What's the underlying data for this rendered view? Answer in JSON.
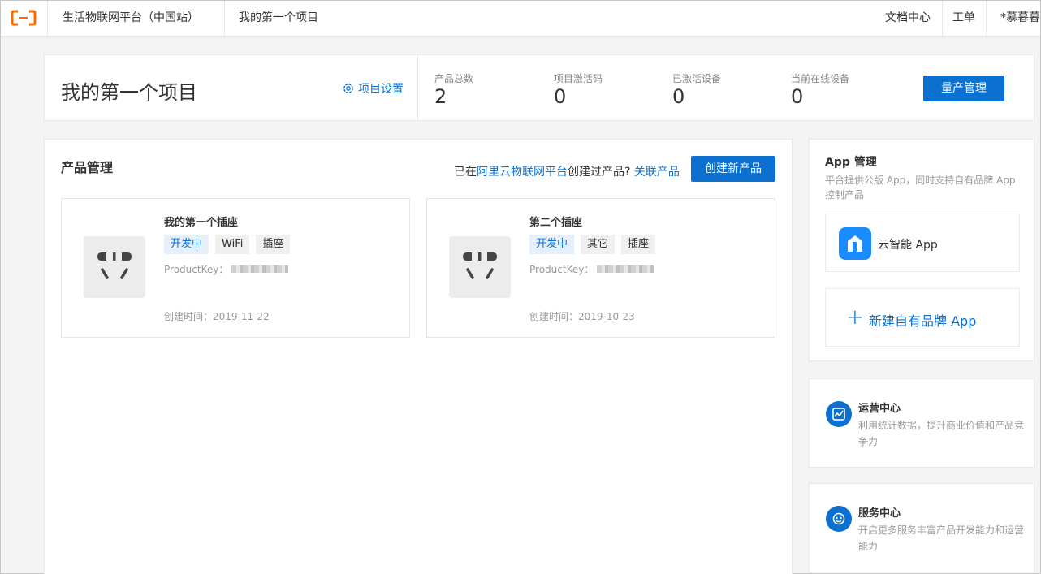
{
  "topbar": {
    "platform": "生活物联网平台（中国站）",
    "project": "我的第一个项目",
    "docs": "文档中心",
    "ticket": "工单",
    "user": "*慕暮暮"
  },
  "project": {
    "title": "我的第一个项目",
    "settings": "项目设置",
    "stats": [
      {
        "label": "产品总数",
        "value": "2"
      },
      {
        "label": "项目激活码",
        "value": "0"
      },
      {
        "label": "已激活设备",
        "value": "0"
      },
      {
        "label": "当前在线设备",
        "value": "0"
      }
    ],
    "mass_button": "量产管理"
  },
  "products": {
    "title": "产品管理",
    "link_prefix": "已在",
    "link_platform": "阿里云物联网平台",
    "link_middle": "创建过产品?",
    "link_associate": "关联产品",
    "create_button": "创建新产品",
    "items": [
      {
        "name": "我的第一个插座",
        "tags": [
          "开发中",
          "WiFi",
          "插座"
        ],
        "pk_label": "ProductKey：",
        "created": "创建时间：2019-11-22"
      },
      {
        "name": "第二个插座",
        "tags": [
          "开发中",
          "其它",
          "插座"
        ],
        "pk_label": "ProductKey：",
        "created": "创建时间：2019-10-23"
      }
    ]
  },
  "apps": {
    "title": "App 管理",
    "desc": "平台提供公版 App，同时支持自有品牌 App 控制产品",
    "public_app": "云智能 App",
    "new_app": "新建自有品牌 App"
  },
  "side": {
    "ops_title": "运营中心",
    "ops_desc": "利用统计数据，提升商业价值和产品竞争力",
    "svc_title": "服务中心",
    "svc_desc": "开启更多服务丰富产品开发能力和运营能力"
  },
  "colors": {
    "accent": "#0b70cf",
    "logo": "#ff6a00"
  }
}
